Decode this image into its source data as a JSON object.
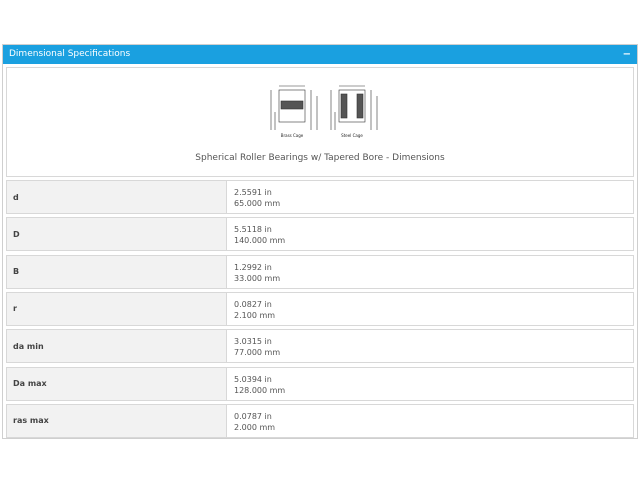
{
  "panel": {
    "title": "Dimensional Specifications",
    "collapse_label": "−"
  },
  "diagram": {
    "caption": "Spherical Roller Bearings w/ Tapered Bore - Dimensions",
    "left_label": "Brass Cage",
    "right_label": "Steel Cage"
  },
  "specs": [
    {
      "name": "d",
      "inch": "2.5591 in",
      "mm": "65.000 mm"
    },
    {
      "name": "D",
      "inch": "5.5118 in",
      "mm": "140.000 mm"
    },
    {
      "name": "B",
      "inch": "1.2992 in",
      "mm": "33.000 mm"
    },
    {
      "name": "r",
      "inch": "0.0827 in",
      "mm": "2.100 mm"
    },
    {
      "name": "da min",
      "inch": "3.0315 in",
      "mm": "77.000 mm"
    },
    {
      "name": "Da max",
      "inch": "5.0394 in",
      "mm": "128.000 mm"
    },
    {
      "name": "ras max",
      "inch": "0.0787 in",
      "mm": "2.000 mm"
    }
  ]
}
